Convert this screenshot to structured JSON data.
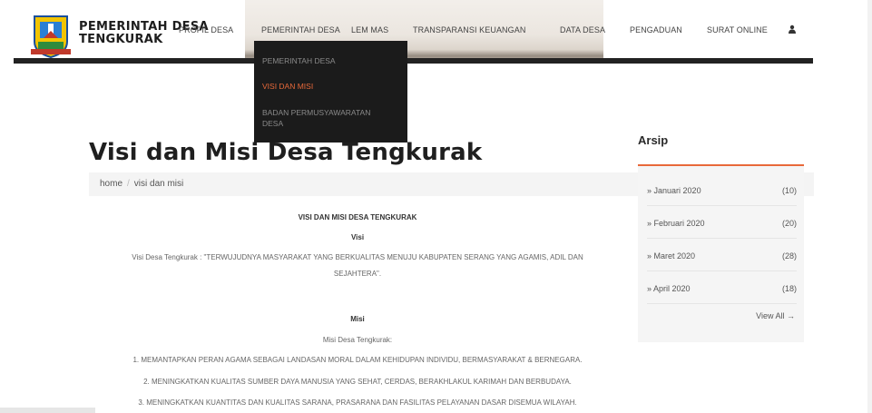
{
  "header": {
    "site_title_line1": "PEMERINTAH DESA",
    "site_title_line2": "TENGKURAK",
    "nav": [
      {
        "label": "PROFIL DESA"
      },
      {
        "label": "PEMERINTAH DESA"
      },
      {
        "label": "LEM MAS"
      },
      {
        "label": "TRANSPARANSI KEUANGAN"
      },
      {
        "label": "DATA DESA"
      },
      {
        "label": "PENGADUAN"
      },
      {
        "label": "SURAT ONLINE"
      }
    ],
    "user_icon": "user-icon"
  },
  "dropdown": {
    "items": [
      {
        "label": "PEMERINTAH DESA"
      },
      {
        "label": "VISI DAN MISI"
      },
      {
        "label": "BADAN PERMUSYAWARATAN"
      },
      {
        "label": "DESA"
      }
    ],
    "active_color": "#e8693a"
  },
  "page": {
    "title": "Visi dan Misi Desa Tengkurak",
    "breadcrumb": {
      "home": "home",
      "sep": "/",
      "current": "visi dan misi"
    }
  },
  "content": {
    "heading": "VISI DAN MISI DESA TENGKURAK",
    "visi_title": "Visi",
    "visi_text_1": "Visi Desa Tengkurak : \"TERWUJUDNYA MASYARAKAT YANG BERKUALITAS MENUJU KABUPATEN SERANG YANG AGAMIS, ADIL DAN",
    "visi_text_2": "SEJAHTERA\".",
    "misi_title": "Misi",
    "misi_intro": "Misi Desa Tengkurak:",
    "misi_items": [
      "1. MEMANTAPKAN PERAN AGAMA SEBAGAI LANDASAN MORAL DALAM KEHIDUPAN INDIVIDU, BERMASYARAKAT & BERNEGARA.",
      "2. MENINGKATKAN KUALITAS SUMBER DAYA MANUSIA YANG SEHAT, CERDAS, BERAKHLAKUL KARIMAH DAN BERBUDAYA.",
      "3. MENINGKATKAN KUANTITAS DAN KUALITAS SARANA, PRASARANA DAN FASILITAS PELAYANAN DASAR DISEMUA WILAYAH."
    ]
  },
  "sidebar": {
    "title": "Arsip",
    "items": [
      {
        "label": "Januari 2020",
        "count": "(10)"
      },
      {
        "label": "Februari 2020",
        "count": "(20)"
      },
      {
        "label": "Maret 2020",
        "count": "(28)"
      },
      {
        "label": "April 2020",
        "count": "(18)"
      }
    ],
    "bullet": "»",
    "view_all": "View All →",
    "accent": "#e8693a"
  }
}
